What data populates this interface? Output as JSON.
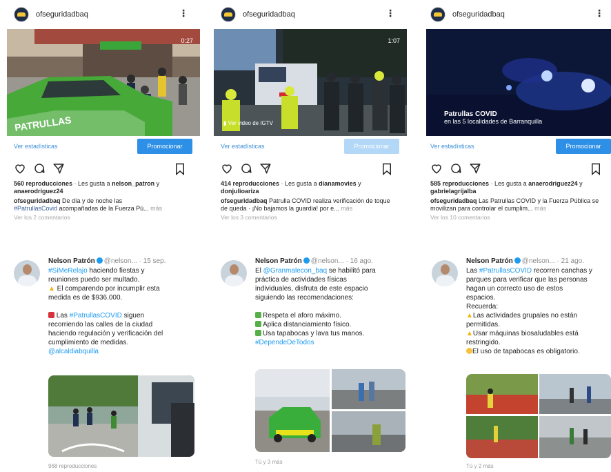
{
  "posts": [
    {
      "username": "ofseguridadbaq",
      "duration": "0:27",
      "stats_link": "Ver estadísticas",
      "promote_label": "Promocionar",
      "views": "560 reproducciones",
      "likes_prefix": " · Les gusta a ",
      "liked_by_1": "nelson_patron",
      "likes_join": " y",
      "liked_by_2": "anaerodriguez24",
      "caption_user": "ofseguridadbaq",
      "caption_text": " De día y de noche las",
      "caption_tag": "#PatrullasCovid",
      "caption_rest": " acompañadas de la Fuerza Pú...",
      "more": "más",
      "comments": "Ver los 2 comentarios"
    },
    {
      "username": "ofseguridadbaq",
      "duration": "1:07",
      "igtv_label": "Ver video de IGTV",
      "stats_link": "Ver estadísticas",
      "promote_label": "Promocionar",
      "views": "414 reproducciones",
      "likes_prefix": " · Les gusta a ",
      "liked_by_1": "dianamovies",
      "likes_join": " y",
      "liked_by_2": "donjulioariza",
      "caption_user": "ofseguridadbaq",
      "caption_text": " Patrulla COVID realiza verificación de toque de queda · ¡No bajamos la guardia! por e...",
      "more": "más",
      "comments": "Ver los 3 comentarios"
    },
    {
      "username": "ofseguridadbaq",
      "overlay_title": "Patrullas COVID",
      "overlay_sub": "en las 5 localidades de Barranquilla",
      "stats_link": "Ver estadísticas",
      "promote_label": "Promocionar",
      "views": "585 reproducciones",
      "likes_prefix": " · Les gusta a ",
      "liked_by_1": "anaerodriguez24",
      "likes_join": " y",
      "liked_by_2": "gabrielagrijalba",
      "caption_user": "ofseguridadbaq",
      "caption_text": " Las Patrullas COVID y la Fuerza Pública se movilizan para controlar el cumplim...",
      "more": "más",
      "comments": "Ver los 10 comentarios"
    }
  ],
  "tweets": [
    {
      "name": "Nelson Patrón",
      "handle": "@nelson...",
      "date": "· 15 sep.",
      "tag1": "#SiMeRelajo",
      "l1": " haciendo fiestas y\nreuniones puedo ser multado.",
      "l2": " El comparendo por incumplir esta\nmedida es de $936.000.",
      "tag2": "#PatrullasCOVID",
      "l3_pre": " Las ",
      "l3_post": " siguen\nrecorriendo las calles de la ciudad\nhaciendo regulación y verificación del\ncumplimiento de medidas.",
      "mention": "@alcaldiabquilla",
      "footer": "968 reproducciones"
    },
    {
      "name": "Nelson Patrón",
      "handle": "@nelson...",
      "date": "· 16 ago.",
      "l1_pre": "El ",
      "mention": "@Granmalecon_baq",
      "l1_post": " se habilitó para\npráctica de actividades físicas\nindividuales, disfruta de este espacio\nsiguiendo las recomendaciones:",
      "c1": "Respeta el aforo máximo.",
      "c2": "Aplica distanciamiento físico.",
      "c3": "Usa tapabocas y lava tus manos.",
      "tag": "#DependeDeTodos",
      "footer": "Tú y 3 más"
    },
    {
      "name": "Nelson Patrón",
      "handle": "@nelson...",
      "date": "· 21 ago.",
      "l1_pre": "Las ",
      "tag": "#PatrullasCOVID",
      "l1_post": " recorren canchas y\nparques para verificar que las personas\nhagan un correcto uso de estos\nespacios.\nRecuerda:",
      "r1": "Las actividades grupales no están\npermitidas.",
      "r2": "Usar máquinas biosaludables está\nrestringido.",
      "r3": "El uso de tapabocas es obligatorio.",
      "footer": "Tú y 2 más"
    }
  ]
}
